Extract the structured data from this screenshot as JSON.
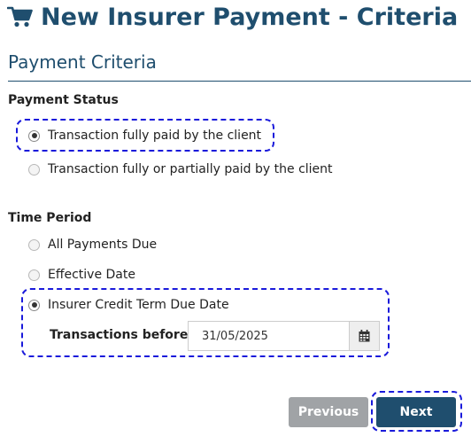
{
  "header": {
    "title": "New Insurer Payment - Criteria",
    "icon": "shopping-cart-icon"
  },
  "section": {
    "title": "Payment Criteria"
  },
  "payment_status": {
    "label": "Payment Status",
    "options": [
      {
        "label": "Transaction fully paid by the client",
        "selected": true
      },
      {
        "label": "Transaction fully or partially paid by the client",
        "selected": false
      }
    ]
  },
  "time_period": {
    "label": "Time Period",
    "options": [
      {
        "label": "All Payments Due",
        "selected": false
      },
      {
        "label": "Effective Date",
        "selected": false
      },
      {
        "label": "Insurer Credit Term Due Date",
        "selected": true
      }
    ],
    "transactions_before": {
      "label": "Transactions before:",
      "value": "31/05/2025",
      "icon": "calendar-icon"
    }
  },
  "buttons": {
    "previous": "Previous",
    "next": "Next"
  },
  "colors": {
    "primary": "#1f4e6e",
    "focus_ring": "#1a1adb",
    "disabled_button": "#a0a3a6"
  }
}
